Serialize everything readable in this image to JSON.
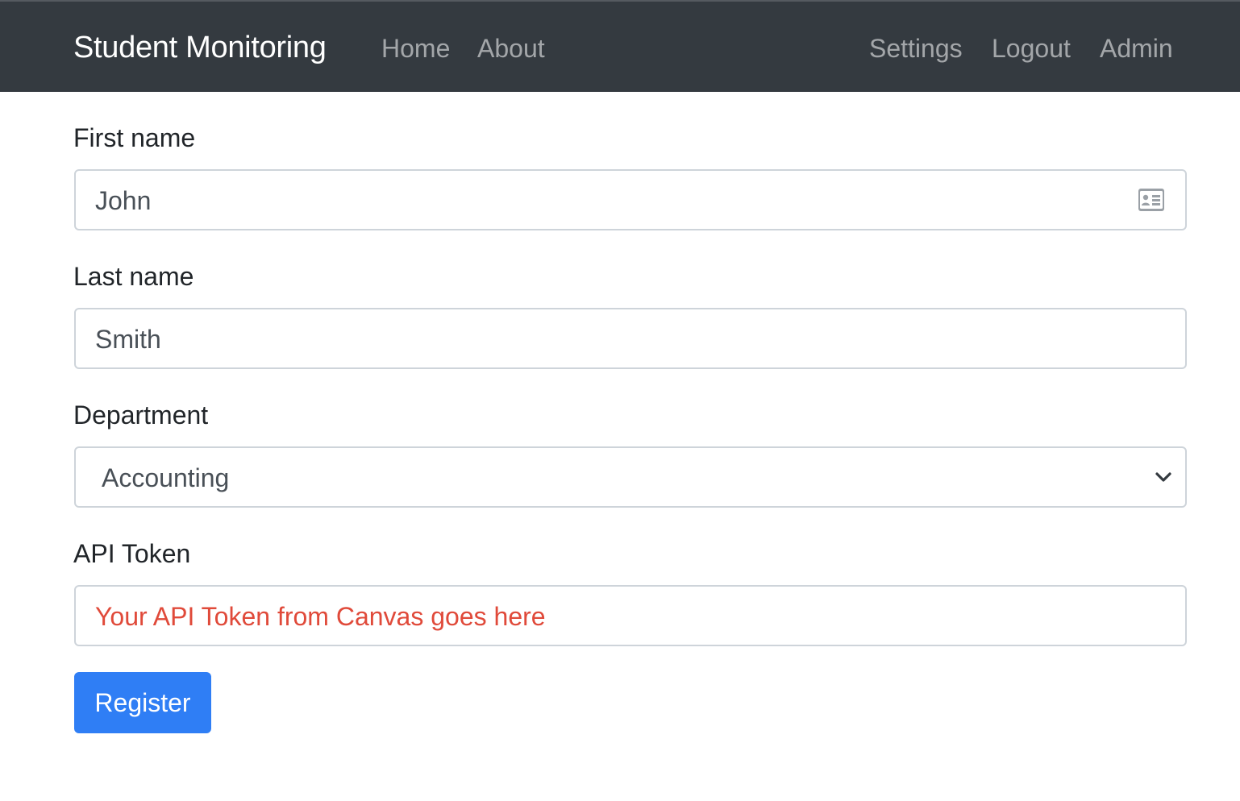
{
  "navbar": {
    "brand": "Student Monitoring",
    "left_links": [
      "Home",
      "About"
    ],
    "right_links": [
      "Settings",
      "Logout",
      "Admin"
    ]
  },
  "form": {
    "first_name": {
      "label": "First name",
      "value": "John",
      "icon": "id-card-icon"
    },
    "last_name": {
      "label": "Last name",
      "value": "Smith"
    },
    "department": {
      "label": "Department",
      "selected": "Accounting",
      "icon": "chevron-down-icon"
    },
    "api_token": {
      "label": "API Token",
      "placeholder": "Your API Token from Canvas goes here",
      "placeholder_color": "#e04a3a"
    },
    "submit_label": "Register"
  },
  "colors": {
    "navbar_bg": "#343a40",
    "primary": "#2f7ef5"
  }
}
